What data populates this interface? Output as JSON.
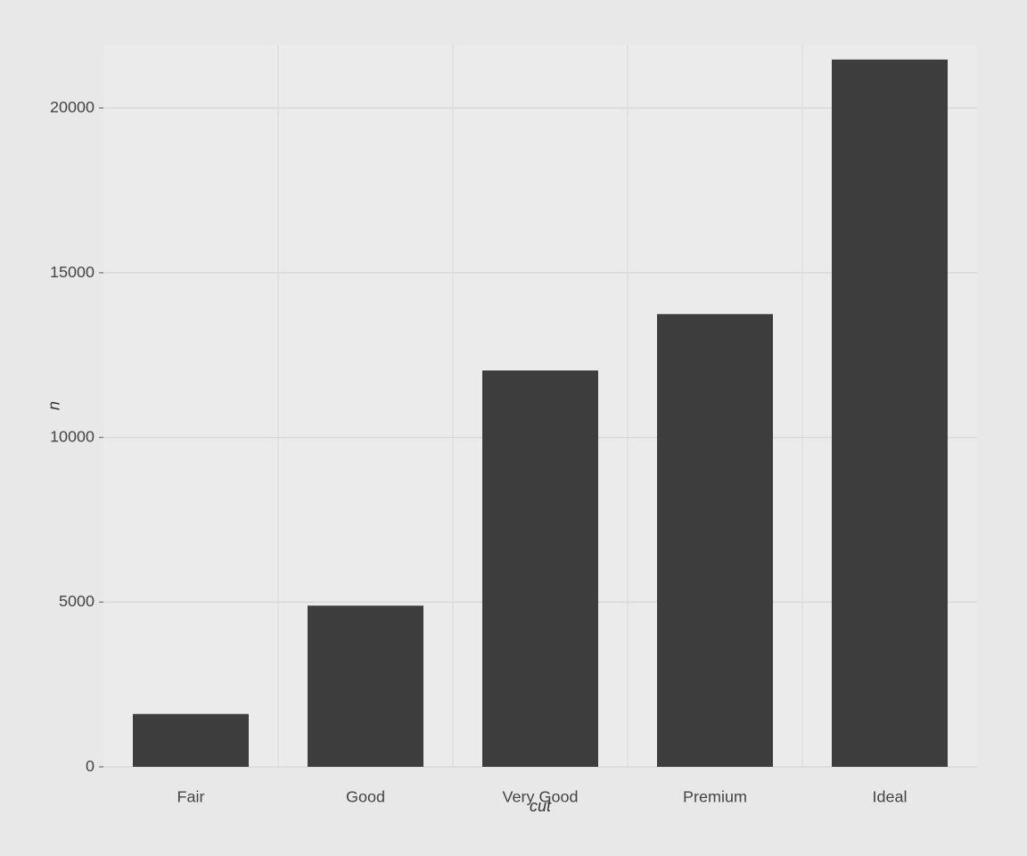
{
  "chart": {
    "title": "",
    "x_axis_label": "cut",
    "y_axis_label": "n",
    "background_color": "#ebebeb",
    "bar_color": "#3d3d3d",
    "grid_color": "#d9d9d9",
    "y_axis": {
      "ticks": [
        0,
        5000,
        10000,
        15000,
        20000
      ],
      "max": 22000
    },
    "bars": [
      {
        "label": "Fair",
        "value": 1610
      },
      {
        "label": "Good",
        "value": 4906
      },
      {
        "label": "Very Good",
        "value": 12082
      },
      {
        "label": "Premium",
        "value": 13791
      },
      {
        "label": "Ideal",
        "value": 21551
      }
    ]
  }
}
